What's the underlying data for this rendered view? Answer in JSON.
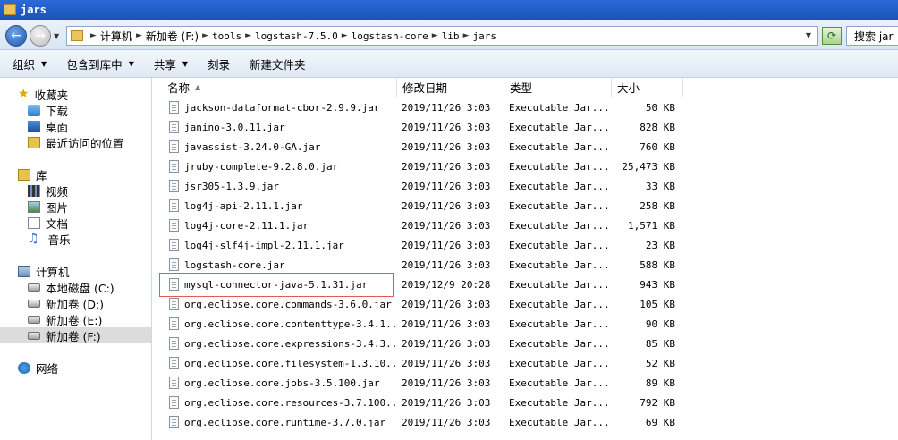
{
  "window": {
    "title": "jars"
  },
  "address": {
    "crumbs": [
      "计算机",
      "新加卷 (F:)",
      "tools",
      "logstash-7.5.0",
      "logstash-core",
      "lib",
      "jars"
    ],
    "search_placeholder": "搜索 jar"
  },
  "toolbar": {
    "organize": "组织",
    "include_in_library": "包含到库中",
    "share": "共享",
    "burn": "刻录",
    "new_folder": "新建文件夹"
  },
  "nav": {
    "favorites": "收藏夹",
    "downloads": "下载",
    "desktop": "桌面",
    "recent": "最近访问的位置",
    "libraries": "库",
    "videos": "视频",
    "pictures": "图片",
    "documents": "文档",
    "music": "音乐",
    "computer": "计算机",
    "drive_c": "本地磁盘 (C:)",
    "drive_d": "新加卷 (D:)",
    "drive_e": "新加卷 (E:)",
    "drive_f": "新加卷 (F:)",
    "network": "网络"
  },
  "columns": {
    "name": "名称",
    "date": "修改日期",
    "type": "类型",
    "size": "大小"
  },
  "files": [
    {
      "name": "jackson-dataformat-cbor-2.9.9.jar",
      "date": "2019/11/26 3:03",
      "type": "Executable Jar...",
      "size": "50 KB"
    },
    {
      "name": "janino-3.0.11.jar",
      "date": "2019/11/26 3:03",
      "type": "Executable Jar...",
      "size": "828 KB"
    },
    {
      "name": "javassist-3.24.0-GA.jar",
      "date": "2019/11/26 3:03",
      "type": "Executable Jar...",
      "size": "760 KB"
    },
    {
      "name": "jruby-complete-9.2.8.0.jar",
      "date": "2019/11/26 3:03",
      "type": "Executable Jar...",
      "size": "25,473 KB"
    },
    {
      "name": "jsr305-1.3.9.jar",
      "date": "2019/11/26 3:03",
      "type": "Executable Jar...",
      "size": "33 KB"
    },
    {
      "name": "log4j-api-2.11.1.jar",
      "date": "2019/11/26 3:03",
      "type": "Executable Jar...",
      "size": "258 KB"
    },
    {
      "name": "log4j-core-2.11.1.jar",
      "date": "2019/11/26 3:03",
      "type": "Executable Jar...",
      "size": "1,571 KB"
    },
    {
      "name": "log4j-slf4j-impl-2.11.1.jar",
      "date": "2019/11/26 3:03",
      "type": "Executable Jar...",
      "size": "23 KB"
    },
    {
      "name": "logstash-core.jar",
      "date": "2019/11/26 3:03",
      "type": "Executable Jar...",
      "size": "588 KB"
    },
    {
      "name": "mysql-connector-java-5.1.31.jar",
      "date": "2019/12/9 20:28",
      "type": "Executable Jar...",
      "size": "943 KB"
    },
    {
      "name": "org.eclipse.core.commands-3.6.0.jar",
      "date": "2019/11/26 3:03",
      "type": "Executable Jar...",
      "size": "105 KB"
    },
    {
      "name": "org.eclipse.core.contenttype-3.4.1...",
      "date": "2019/11/26 3:03",
      "type": "Executable Jar...",
      "size": "90 KB"
    },
    {
      "name": "org.eclipse.core.expressions-3.4.3...",
      "date": "2019/11/26 3:03",
      "type": "Executable Jar...",
      "size": "85 KB"
    },
    {
      "name": "org.eclipse.core.filesystem-1.3.10...",
      "date": "2019/11/26 3:03",
      "type": "Executable Jar...",
      "size": "52 KB"
    },
    {
      "name": "org.eclipse.core.jobs-3.5.100.jar",
      "date": "2019/11/26 3:03",
      "type": "Executable Jar...",
      "size": "89 KB"
    },
    {
      "name": "org.eclipse.core.resources-3.7.100...",
      "date": "2019/11/26 3:03",
      "type": "Executable Jar...",
      "size": "792 KB"
    },
    {
      "name": "org.eclipse.core.runtime-3.7.0.jar",
      "date": "2019/11/26 3:03",
      "type": "Executable Jar...",
      "size": "69 KB"
    }
  ],
  "colors": {
    "titlebar": "#1c53b8",
    "highlight": "#e05a5a",
    "selected_nav": "#dcdcdc"
  }
}
